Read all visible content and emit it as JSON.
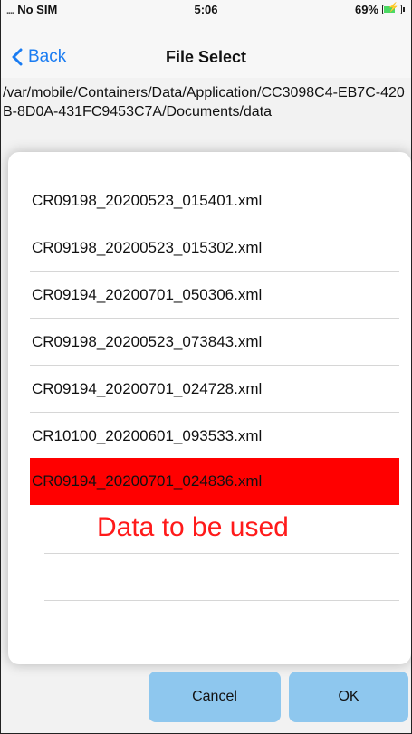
{
  "status_bar": {
    "signal_dots": "....",
    "carrier": "No SIM",
    "time": "5:06",
    "battery_percent": "69%",
    "battery_level": 0.69
  },
  "nav": {
    "back_label": "Back",
    "title": "File Select"
  },
  "path": "/var/mobile/Containers/Data/Application/CC3098C4-EB7C-420B-8D0A-431FC9453C7A/Documents/data",
  "files": [
    "CR09198_20200523_015401.xml",
    "CR09198_20200523_015302.xml",
    "CR09194_20200701_050306.xml",
    "CR09198_20200523_073843.xml",
    "CR09194_20200701_024728.xml",
    "CR10100_20200601_093533.xml",
    "CR09194_20200701_024836.xml"
  ],
  "selected_index": 6,
  "annotation": "Data to be used",
  "buttons": {
    "cancel": "Cancel",
    "ok": "OK"
  },
  "colors": {
    "accent": "#1a7cf2",
    "selected_row": "#ff0000",
    "annotation": "#ff1a1a",
    "button": "#8ec7ee"
  }
}
